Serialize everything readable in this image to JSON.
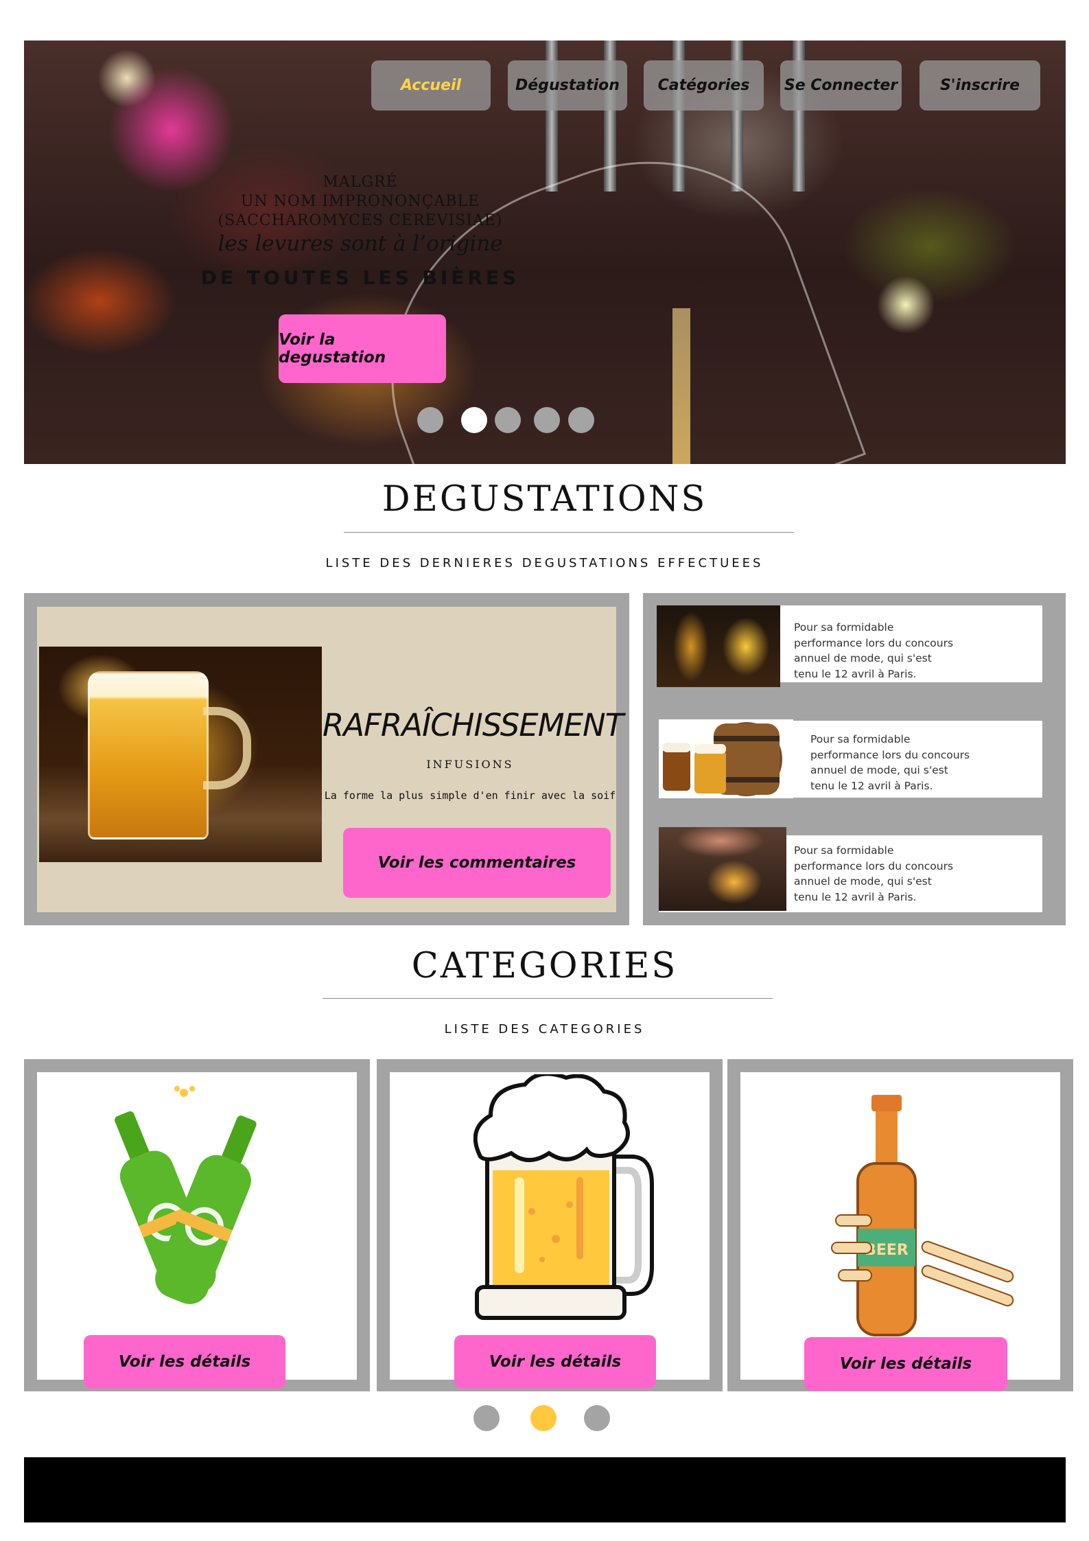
{
  "nav": {
    "items": [
      {
        "label": "Accueil",
        "active": true
      },
      {
        "label": "Dégustation"
      },
      {
        "label": "Catégories"
      },
      {
        "label": "Se Connecter"
      },
      {
        "label": "S'inscrire"
      }
    ]
  },
  "hero": {
    "line1": "MALGRÉ",
    "line2": "UN NOM IMPRONONÇABLE",
    "line3": "(SACCHAROMYCES CEREVISIAE)",
    "line4": "les levures sont à l’origine",
    "line5": "DE TOUTES LES BIÈRES",
    "cta": "Voir la degustation"
  },
  "degustations": {
    "title": "DEGUSTATIONS",
    "subtitle": "LISTE DES DERNIERES DEGUSTATIONS EFFECTUEES",
    "featured": {
      "title": "RAFRAÎCHISSEMENT",
      "subtitle": "INFUSIONS",
      "description": "La forme la plus simple d'en finir avec la soif",
      "button": "Voir les commentaires"
    },
    "side_items": [
      {
        "lines": [
          "Pour sa formidable",
          "performance lors du concours",
          "annuel de mode, qui s'est",
          "tenu le 12 avril à Paris."
        ]
      },
      {
        "lines": [
          "Pour sa formidable",
          "performance lors du concours",
          "annuel de mode, qui s'est",
          "tenu le 12 avril à Paris."
        ]
      },
      {
        "lines": [
          "Pour sa formidable",
          "performance lors du concours",
          "annuel de mode, qui s'est",
          "tenu le 12 avril à Paris."
        ]
      }
    ]
  },
  "categories": {
    "title": "CATEGORIES",
    "subtitle": "LISTE DES CATEGORIES",
    "items": [
      {
        "button": "Voir les détails"
      },
      {
        "button": "Voir les détails"
      },
      {
        "button": "Voir les détails",
        "bottle_label": "BEER"
      }
    ]
  },
  "colors": {
    "accent_pink": "#ff66cc",
    "nav_active": "#ffd447",
    "frame_grey": "#a4a4a4",
    "dot_active": "#ffc83d",
    "featured_bg": "#ddd3bd",
    "footer": "#000000"
  }
}
